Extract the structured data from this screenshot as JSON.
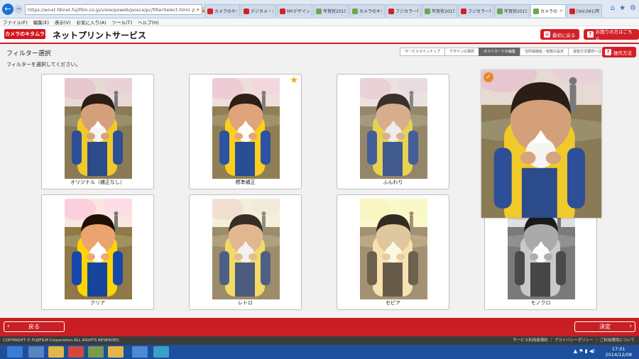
{
  "browser": {
    "url": "https://wnxt.fdinet.fujifilm.co.jp/view/poweb/posca/pc/filterSelect.html",
    "url_tools": "ρ ▾ 🔒 ⊘ C ×",
    "tabs": [
      {
        "label": "カメラのキタム...",
        "color": "#d41f26",
        "active": false
      },
      {
        "label": "デジカメ・デジ...",
        "color": "#d41f26",
        "active": false
      },
      {
        "label": "MYデザイン年...",
        "color": "#d41f26",
        "active": false
      },
      {
        "label": "年賀状2015",
        "color": "#6aa84f",
        "active": false
      },
      {
        "label": "カメラのキタム...",
        "color": "#6aa84f",
        "active": false
      },
      {
        "label": "フジカラー年...",
        "color": "#d41f26",
        "active": false
      },
      {
        "label": "年賀状2015",
        "color": "#6aa84f",
        "active": false
      },
      {
        "label": "フジカラー年...",
        "color": "#d41f26",
        "active": false
      },
      {
        "label": "年賀状2015",
        "color": "#6aa84f",
        "active": false
      },
      {
        "label": "カメラのキ...",
        "color": "#6aa84f",
        "active": true
      },
      {
        "label": "[Vol.041]年...",
        "color": "#d41f26",
        "active": false
      }
    ],
    "menu": [
      "ファイル(F)",
      "編集(E)",
      "表示(V)",
      "お気に入り(A)",
      "ツール(T)",
      "ヘルプ(H)"
    ]
  },
  "header": {
    "logo": "カメラのキタムラ",
    "title": "ネットプリントサービス",
    "back_to_site": "最初に戻る",
    "help": "お困りの方はこちら"
  },
  "page": {
    "title": "フィルター選択",
    "instruction": "フィルターを選択してください。",
    "how_to": "操作方法",
    "steps": [
      {
        "label": "サービスラインナップ",
        "active": false
      },
      {
        "label": "デザインの選択",
        "active": false
      },
      {
        "label": "ポストカードの編集",
        "active": true
      },
      {
        "label": "住所録機能・枚数の設定",
        "active": false
      },
      {
        "label": "受取方法選択～注文完了",
        "active": false
      }
    ]
  },
  "filters": [
    {
      "id": "original",
      "label": "オリジナル（補正なし）",
      "recommended": false
    },
    {
      "id": "standard",
      "label": "標準補正",
      "recommended": true
    },
    {
      "id": "soft",
      "label": "ふんわり",
      "recommended": false
    },
    {
      "id": "clear",
      "label": "クリア",
      "recommended": false
    },
    {
      "id": "retro",
      "label": "レトロ",
      "recommended": false
    },
    {
      "id": "sepia",
      "label": "セピア",
      "recommended": false
    },
    {
      "id": "mono",
      "label": "モノクロ",
      "recommended": false
    }
  ],
  "footer": {
    "back": "戻る",
    "confirm": "決定",
    "copyright": "COPYRIGHT © FUJIFILM Corporation ALL RIGHTS RESERVED.",
    "links": "サービス利用者規約 ｜ プライバシーポリシー ｜ ご利用環境について"
  },
  "taskbar": {
    "time": "17:01",
    "date": "2014/12/08"
  },
  "colors": {
    "accent": "#d41f26",
    "check": "#e7892b",
    "star": "#f2a900"
  }
}
